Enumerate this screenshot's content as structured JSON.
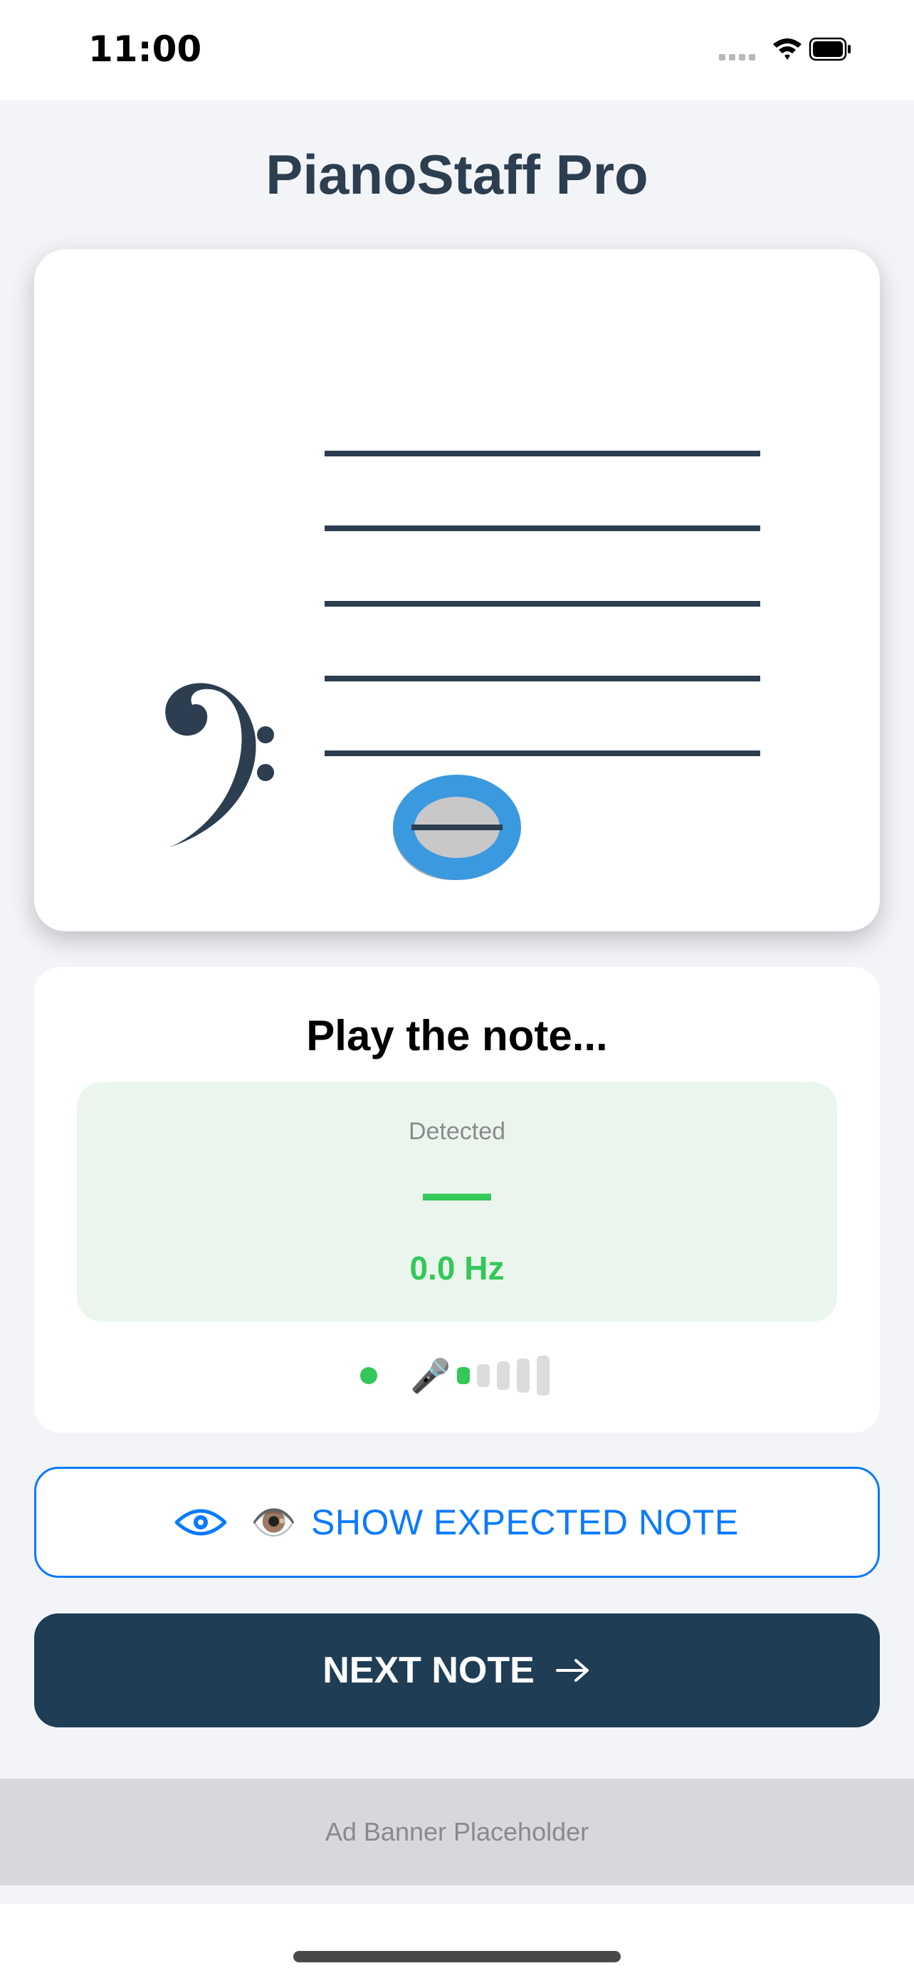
{
  "status_bar": {
    "time": "11:00",
    "icons": [
      "cellular-signal-icon",
      "wifi-icon",
      "battery-icon"
    ]
  },
  "app": {
    "title": "PianoStaff Pro"
  },
  "staff": {
    "clef": "bass",
    "clef_glyph": "𝄢",
    "line_count": 5,
    "note": {
      "type": "whole",
      "ledger_line": true,
      "color": "#3b99e0"
    }
  },
  "practice": {
    "prompt": "Play the note...",
    "detected_label": "Detected",
    "detected_note": "—",
    "frequency": "0.0 Hz",
    "mic_icon": "🎤",
    "input_level": {
      "active_bars": 1,
      "total_bars": 5
    }
  },
  "buttons": {
    "show_expected_emoji": "👁️",
    "show_expected_label": "SHOW EXPECTED NOTE",
    "next_label": "NEXT NOTE"
  },
  "ad": {
    "label": "Ad Banner Placeholder"
  },
  "colors": {
    "accent": "#0a7aff",
    "primary_dark": "#1f3d55",
    "success": "#34c759",
    "title": "#2c3e50"
  }
}
